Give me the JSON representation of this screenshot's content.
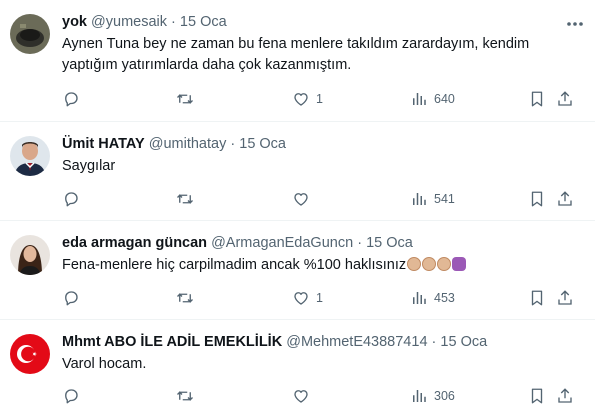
{
  "tweets": [
    {
      "name": "yok",
      "handle": "@yumesaik",
      "sep": "·",
      "time": "15 Oca",
      "text": "Aynen Tuna bey ne zaman bu fena menlere takıldım zarardayım, kendim yaptığım yatırımlarda daha çok kazanmıştım.",
      "likes": "1",
      "views": "640"
    },
    {
      "name": "Ümit HATAY",
      "handle": "@umithatay",
      "sep": "·",
      "time": "15 Oca",
      "text": "Saygılar",
      "likes": "",
      "views": "541"
    },
    {
      "name": "eda armagan güncan",
      "handle": "@ArmaganEdaGuncn",
      "sep": "·",
      "time": "15 Oca",
      "text": "Fena-menlere hiç carpilmadim ancak %100 haklısınız",
      "emojis": [
        "clapping-hands",
        "clapping-hands",
        "clapping-hands",
        "person-facepalming"
      ],
      "likes": "1",
      "views": "453"
    },
    {
      "name": "Mhmt ABO İLE ADİL EMEKLİLİK",
      "handle": "@MehmetE43887414",
      "sep": "·",
      "time": "15 Oca",
      "text": "Varol hocam.",
      "likes": "",
      "views": "306"
    }
  ],
  "icons": {
    "more": "more-horizontal-icon",
    "reply": "reply-icon",
    "retweet": "retweet-icon",
    "like": "heart-icon",
    "views": "views-icon",
    "bookmark": "bookmark-icon",
    "share": "share-icon"
  },
  "colors": {
    "text": "#0f1419",
    "secondary": "#536471",
    "divider": "#eff3f4",
    "flag_red": "#e30a17"
  }
}
